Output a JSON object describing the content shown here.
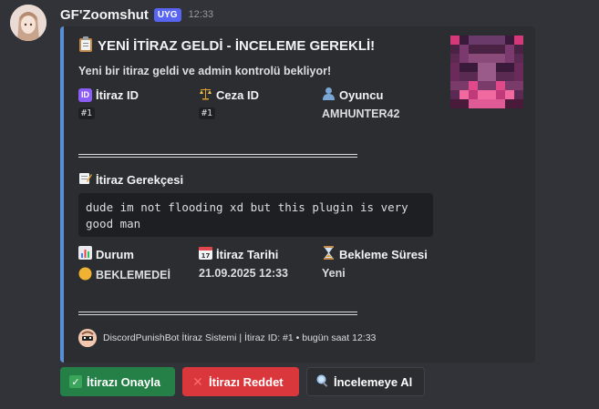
{
  "message": {
    "username": "GF'Zoomshut",
    "tag": "UYG",
    "timestamp": "12:33"
  },
  "embed": {
    "accent_color": "#5a8fd8",
    "title": "YENİ İTİRAZ GELDİ - İNCELEME GEREKLİ!",
    "title_icon": "clipboard-icon",
    "description": "Yeni bir itiraz geldi ve admin kontrolü bekliyor!",
    "fields_row1": [
      {
        "name": "İtiraz ID",
        "value": "#1",
        "icon": "id-icon",
        "code": true
      },
      {
        "name": "Ceza ID",
        "value": "#1",
        "icon": "scales-icon",
        "code": true
      },
      {
        "name": "Oyuncu",
        "value": "AMHUNTER42",
        "icon": "user-icon",
        "code": false
      }
    ],
    "separator": "═══════════════════════════════",
    "reason_label": "İtiraz Gerekçesi",
    "reason_icon": "memo-icon",
    "reason_text": "dude im not flooding xd but this plugin is very good man",
    "fields_row2": [
      {
        "name": "Durum",
        "value": "BEKLEMEDEİ",
        "icon": "chart-icon"
      },
      {
        "name": "İtiraz Tarihi",
        "value": "21.09.2025 12:33",
        "icon": "calendar-icon"
      },
      {
        "name": "Bekleme Süresi",
        "value": "Yeni",
        "icon": "hourglass-icon"
      }
    ],
    "status_color": "#f0b232",
    "footer": "DiscordPunishBot İtiraz Sistemi | İtiraz ID: #1 • bugün saat 12:33"
  },
  "buttons": {
    "approve": "İtirazı Onayla",
    "reject": "İtirazı Reddet",
    "review": "İncelemeye Al"
  }
}
